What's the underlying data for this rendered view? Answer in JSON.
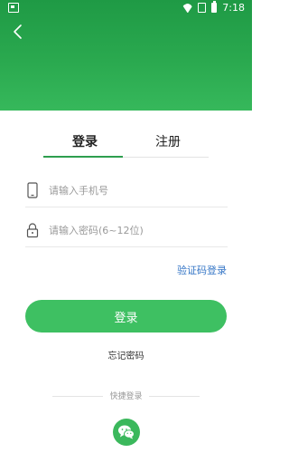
{
  "status_bar": {
    "time": "7:18"
  },
  "tabs": {
    "login": "登录",
    "register": "注册"
  },
  "form": {
    "phone_placeholder": "请输入手机号",
    "password_placeholder": "请输入密码(6~12位)"
  },
  "links": {
    "sms_login": "验证码登录",
    "forgot_password": "忘记密码"
  },
  "buttons": {
    "login": "登录"
  },
  "quick_login": {
    "label": "快捷登录"
  },
  "colors": {
    "header_green": "#2aa94f",
    "button_green": "#3ec062",
    "link_blue": "#3576c6",
    "indicator_green": "#2e9e4e"
  },
  "icons": {
    "back": "back-arrow-icon",
    "phone": "phone-icon",
    "lock": "lock-icon",
    "wechat": "wechat-icon"
  }
}
